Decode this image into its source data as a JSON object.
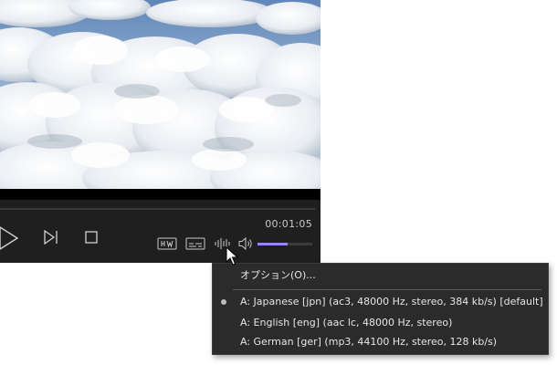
{
  "player": {
    "timecode": "00:01:05",
    "seek_progress": 0.0,
    "volume_level": 0.55,
    "accent_color": "#8f84ea",
    "buttons": {
      "play": "play-icon",
      "next": "skip-next-icon",
      "stop": "stop-icon",
      "hw": "hw-decoding-icon",
      "subtitles": "subtitles-icon",
      "audio_track": "audio-track-icon",
      "volume": "speaker-icon"
    }
  },
  "menu": {
    "options_label": "オプション(O)...",
    "tracks": [
      {
        "label": "A: Japanese [jpn] (ac3, 48000 Hz, stereo, 384 kb/s) [default]",
        "selected": true
      },
      {
        "label": "A: English [eng] (aac lc, 48000 Hz, stereo)",
        "selected": false
      },
      {
        "label": "A: German [ger] (mp3, 44100 Hz, stereo, 128 kb/s)",
        "selected": false
      }
    ]
  }
}
